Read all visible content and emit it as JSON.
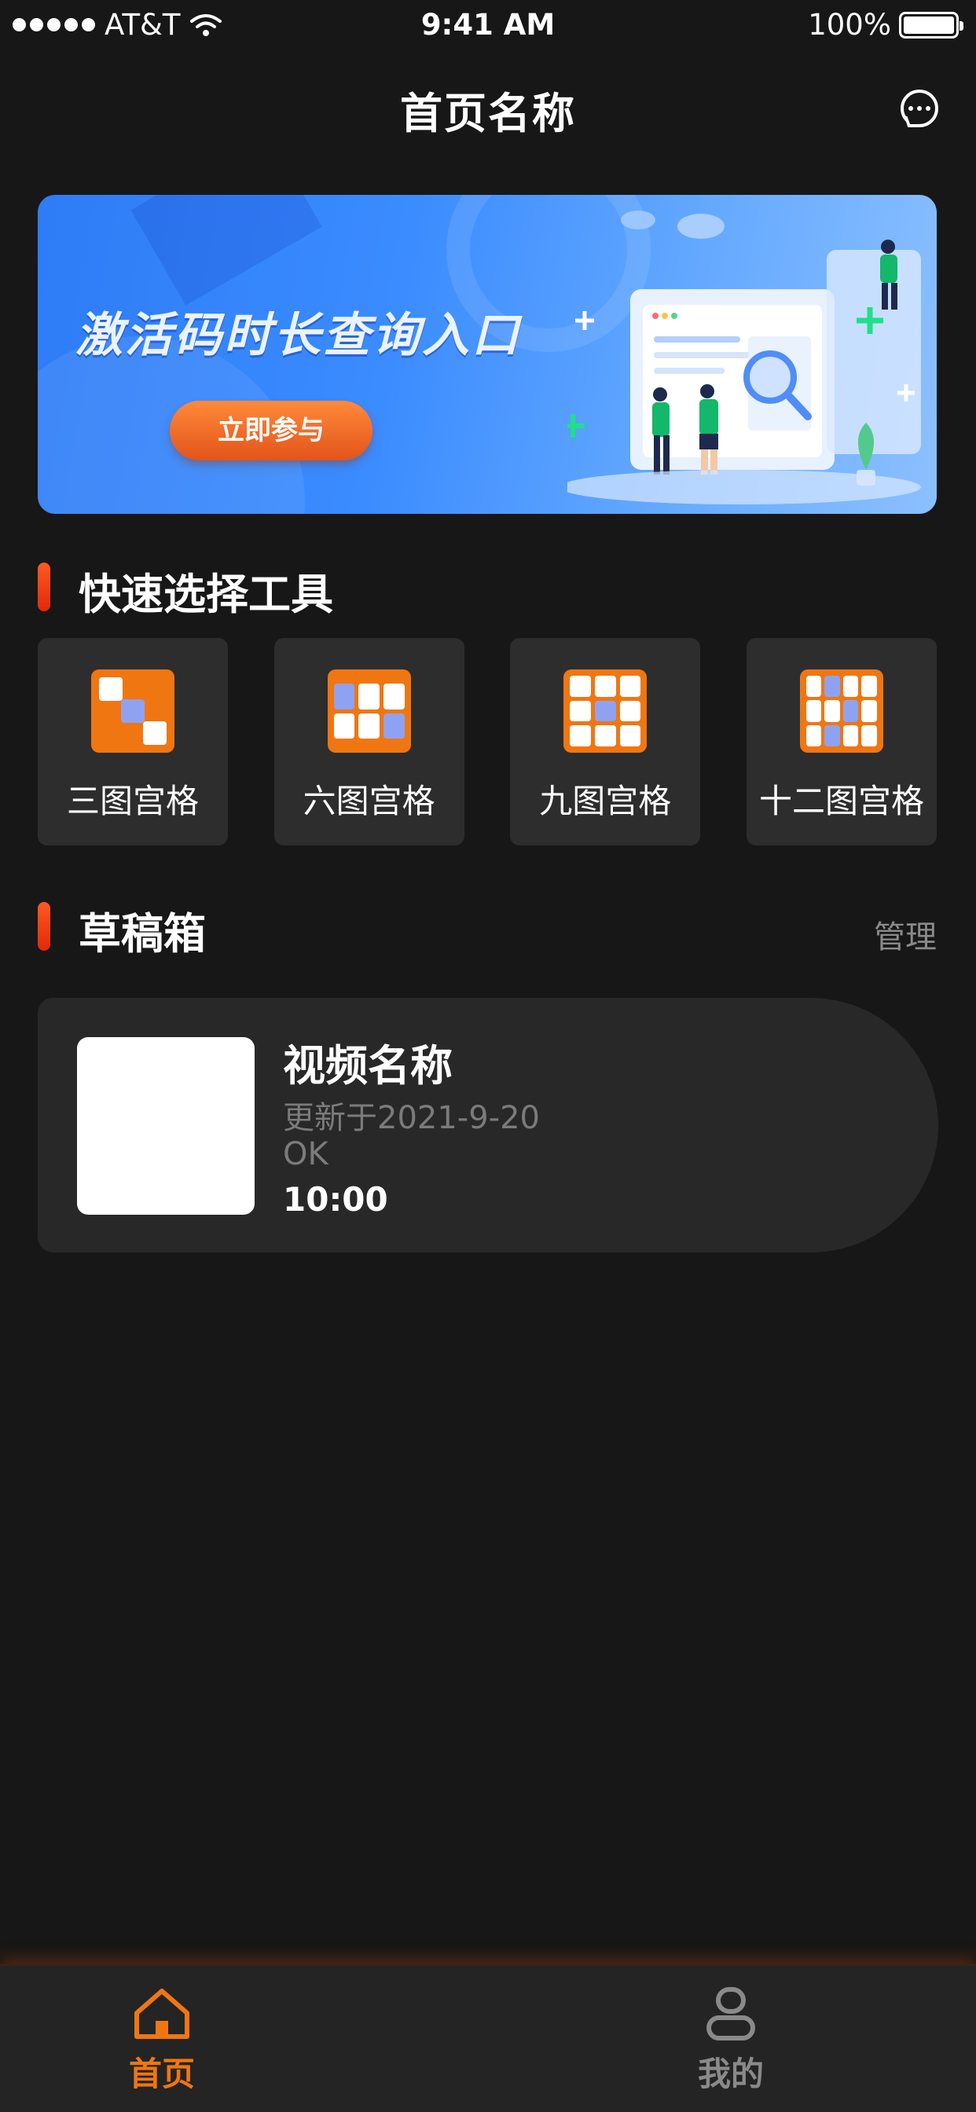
{
  "status_bar": {
    "carrier": "AT&T",
    "time": "9:41 AM",
    "battery": "100%",
    "battery_level": 1.0
  },
  "header": {
    "title": "首页名称",
    "message_icon": "chat-bubble-icon"
  },
  "banner": {
    "title": "激活码时长查询入口",
    "button_label": "立即参与"
  },
  "quick_tools": {
    "section_title": "快速选择工具",
    "items": [
      {
        "label": "三图宫格",
        "icon": "three-grid-icon"
      },
      {
        "label": "六图宫格",
        "icon": "six-grid-icon"
      },
      {
        "label": "九图宫格",
        "icon": "nine-grid-icon"
      },
      {
        "label": "十二图宫格",
        "icon": "twelve-grid-icon"
      }
    ]
  },
  "drafts": {
    "section_title": "草稿箱",
    "manage_label": "管理",
    "items": [
      {
        "name": "视频名称",
        "updated": "更新于2021-9-20",
        "status": "OK",
        "duration": "10:00"
      }
    ]
  },
  "tab_bar": {
    "items": [
      {
        "label": "首页",
        "icon": "home-icon",
        "active": true
      },
      {
        "label": "我的",
        "icon": "profile-icon",
        "active": false
      }
    ]
  },
  "colors": {
    "background": "#171717",
    "accent": "#f07612",
    "card": "#2d2d2d",
    "banner_blue": "#3b8cff"
  }
}
